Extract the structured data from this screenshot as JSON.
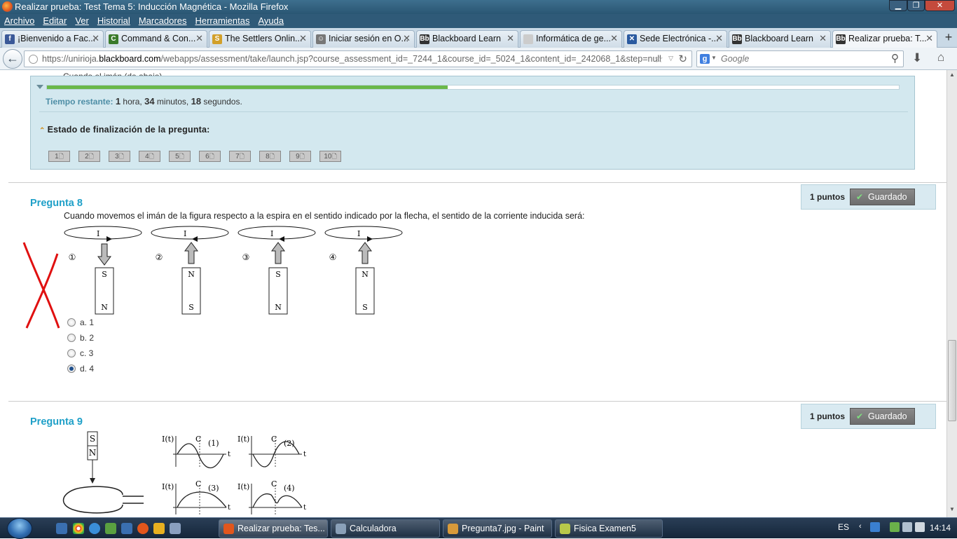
{
  "window": {
    "title": "Realizar prueba: Test Tema 5: Inducción Magnética - Mozilla Firefox",
    "min": "▁",
    "max": "❐",
    "close": "✕"
  },
  "menu": [
    "Archivo",
    "Editar",
    "Ver",
    "Historial",
    "Marcadores",
    "Herramientas",
    "Ayuda"
  ],
  "tabs": [
    {
      "label": "¡Bienvenido a Fac...",
      "icon": "f",
      "color": "#3b5998"
    },
    {
      "label": "Command & Con...",
      "icon": "C",
      "color": "#3a7a2a"
    },
    {
      "label": "The Settlers Onlin...",
      "icon": "S",
      "color": "#d2a02a"
    },
    {
      "label": "Iniciar sesión en O...",
      "icon": "☺",
      "color": "#777"
    },
    {
      "label": "Blackboard Learn",
      "icon": "Bb",
      "color": "#333"
    },
    {
      "label": "Informática de ge...",
      "icon": "",
      "color": "#ccc"
    },
    {
      "label": "Sede Electrónica -...",
      "icon": "✕",
      "color": "#2a5aa0"
    },
    {
      "label": "Blackboard Learn",
      "icon": "Bb",
      "color": "#333"
    },
    {
      "label": "Realizar prueba: T...",
      "icon": "Bb",
      "color": "#333"
    }
  ],
  "tab_close": "✕",
  "new_tab": "+",
  "nav": {
    "url_prefix": "https://unirioja.",
    "url_domain": "blackboard.com",
    "url_path": "/webapps/assessment/take/launch.jsp?course_assessment_id=_7244_1&course_id=_5024_1&content_id=_242068_1&step=null",
    "search_placeholder": "Google"
  },
  "cutoff_text": "Cuando el imán (de abajo) ...",
  "timer": {
    "label": "Tiempo restante:",
    "hours": "1",
    "hours_unit": "hora,",
    "minutes": "34",
    "minutes_unit": "minutos,",
    "seconds": "18",
    "seconds_unit": "segundos.",
    "progress_fraction": 0.47
  },
  "status": {
    "heading": "Estado de finalización de la pregunta:",
    "buttons": [
      "1",
      "2",
      "3",
      "4",
      "5",
      "6",
      "7",
      "8",
      "9",
      "10"
    ]
  },
  "q8": {
    "title": "Pregunta 8",
    "points": "1 puntos",
    "saved": "Guardado",
    "text": "Cuando movemos el imán de la figura respecto a la espira en el sentido indicado por la flecha, el sentido de la corriente inducida será:",
    "figure": {
      "current_label": "I",
      "labels": [
        "①",
        "②",
        "③",
        "④"
      ],
      "magnets": [
        [
          "S",
          "N"
        ],
        [
          "N",
          "S"
        ],
        [
          "S",
          "N"
        ],
        [
          "N",
          "S"
        ]
      ]
    },
    "options": [
      {
        "label": "a. 1",
        "selected": false
      },
      {
        "label": "b. 2",
        "selected": false
      },
      {
        "label": "c. 3",
        "selected": false
      },
      {
        "label": "d. 4",
        "selected": true
      }
    ]
  },
  "q9": {
    "title": "Pregunta 9",
    "points": "1 puntos",
    "saved": "Guardado",
    "figure": {
      "magnet": [
        "S",
        "N"
      ],
      "axis_y": "I(t)",
      "axis_x": "t",
      "mark": "C",
      "graph_labels": [
        "(1)",
        "(2)",
        "(3)",
        "(4)"
      ]
    }
  },
  "taskbar": {
    "items": [
      {
        "label": "Realizar prueba: Tes...",
        "color": "#e2561c",
        "active": true
      },
      {
        "label": "Calculadora",
        "color": "#8aa0b8",
        "active": false
      },
      {
        "label": "Pregunta7.jpg - Paint",
        "color": "#d89a3a",
        "active": false
      },
      {
        "label": "Fisica Examen5",
        "color": "#b8c84a",
        "active": false
      }
    ],
    "lang": "ES",
    "clock": "14:14"
  }
}
